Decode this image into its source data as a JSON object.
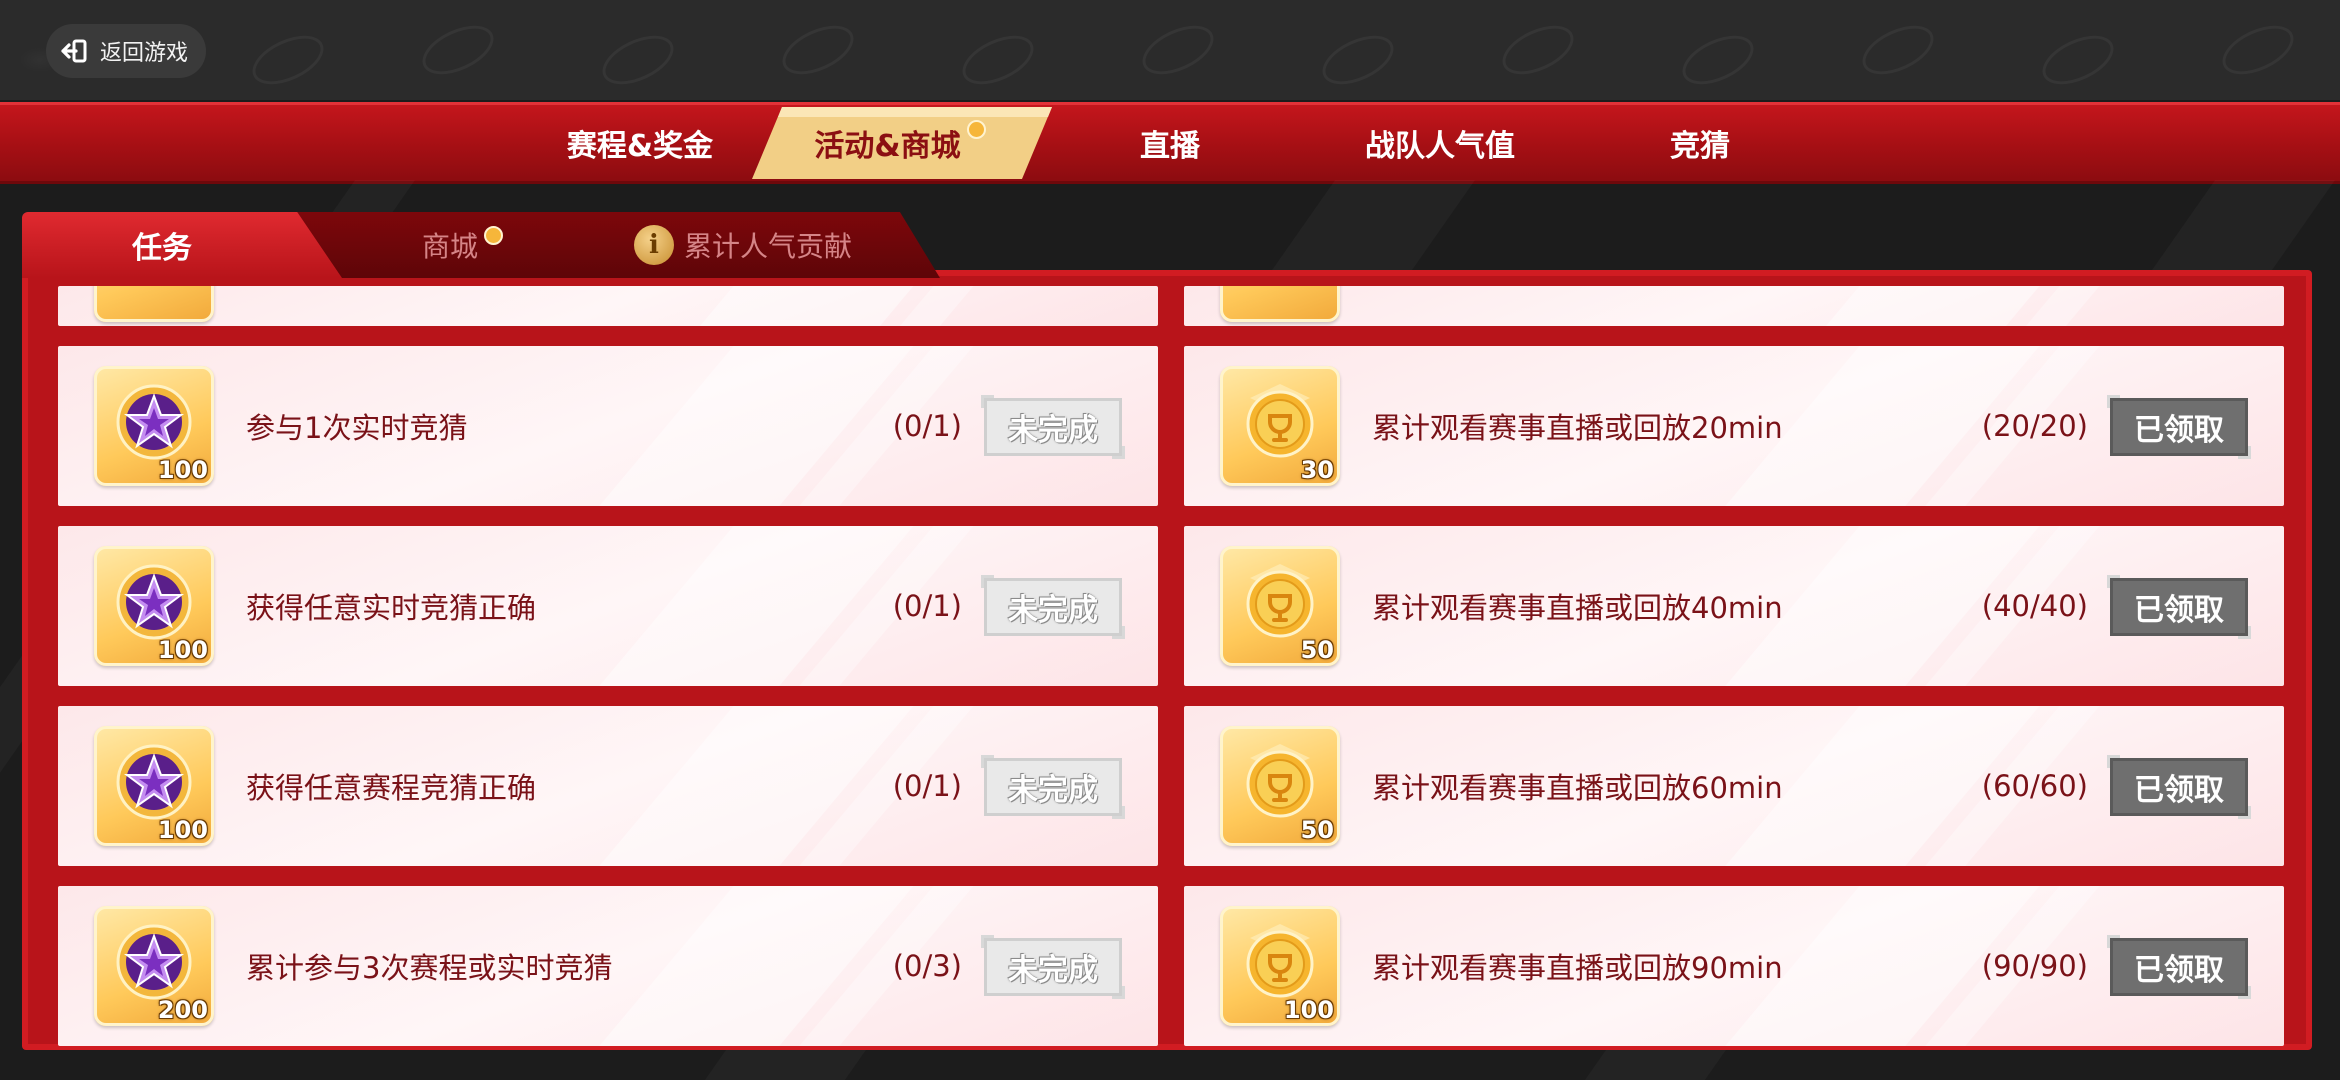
{
  "back_button": {
    "label": "返回游戏",
    "icon": "exit-icon"
  },
  "main_nav": {
    "tabs": [
      {
        "label": "赛程&奖金"
      },
      {
        "label": "活动&商城",
        "active": true,
        "has_dot": true
      },
      {
        "label": "直播"
      },
      {
        "label": "战队人气值"
      },
      {
        "label": "竞猜"
      }
    ]
  },
  "sub_tabs": {
    "task": "任务",
    "shop": "商城",
    "contrib": "累计人气贡献"
  },
  "colors": {
    "accent_red": "#b8141a",
    "active_tab_gold": "#f2cf86",
    "text_red": "#7a1218",
    "done_button": "#6f6f6f",
    "todo_button": "#e9e9e9"
  },
  "left_tasks": [
    {
      "title": "参与1次实时竞猜",
      "progress": "(0/1)",
      "status": "未完成",
      "reward_icon": "star-badge-icon",
      "reward_qty": "100"
    },
    {
      "title": "获得任意实时竞猜正确",
      "progress": "(0/1)",
      "status": "未完成",
      "reward_icon": "star-badge-icon",
      "reward_qty": "100"
    },
    {
      "title": "获得任意赛程竞猜正确",
      "progress": "(0/1)",
      "status": "未完成",
      "reward_icon": "star-badge-icon",
      "reward_qty": "100"
    },
    {
      "title": "累计参与3次赛程或实时竞猜",
      "progress": "(0/3)",
      "status": "未完成",
      "reward_icon": "star-badge-icon",
      "reward_qty": "200"
    }
  ],
  "right_tasks": [
    {
      "title": "累计观看赛事直播或回放20min",
      "progress": "(20/20)",
      "status": "已领取",
      "reward_icon": "gold-coin-icon",
      "reward_qty": "30"
    },
    {
      "title": "累计观看赛事直播或回放40min",
      "progress": "(40/40)",
      "status": "已领取",
      "reward_icon": "gold-coin-icon",
      "reward_qty": "50"
    },
    {
      "title": "累计观看赛事直播或回放60min",
      "progress": "(60/60)",
      "status": "已领取",
      "reward_icon": "gold-coin-icon",
      "reward_qty": "50"
    },
    {
      "title": "累计观看赛事直播或回放90min",
      "progress": "(90/90)",
      "status": "已领取",
      "reward_icon": "gold-coin-icon",
      "reward_qty": "100"
    }
  ]
}
